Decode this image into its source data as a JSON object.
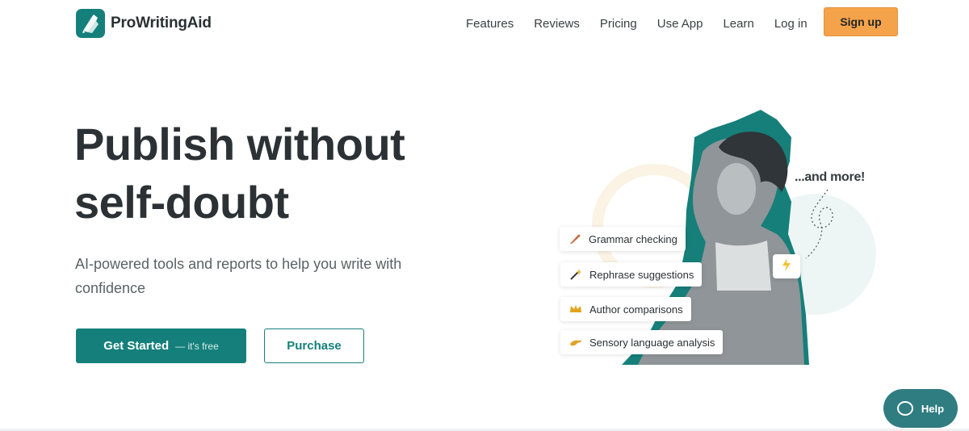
{
  "brand": {
    "name": "ProWritingAid",
    "accent": "#15807b",
    "signup_color": "#f5a34a"
  },
  "nav": {
    "items": [
      {
        "label": "Features"
      },
      {
        "label": "Reviews"
      },
      {
        "label": "Pricing"
      },
      {
        "label": "Use App"
      },
      {
        "label": "Learn"
      },
      {
        "label": "Log in"
      }
    ],
    "signup_label": "Sign up"
  },
  "hero": {
    "headline_line1": "Publish without",
    "headline_line2": "self-doubt",
    "subhead": "AI-powered tools and reports to help you write with confidence",
    "primary_label": "Get Started",
    "primary_sub": "— it's free",
    "secondary_label": "Purchase"
  },
  "illustration": {
    "and_more": "...and more!",
    "features": [
      {
        "label": "Grammar checking",
        "icon": "quill-icon"
      },
      {
        "label": "Rephrase suggestions",
        "icon": "magic-wand-icon"
      },
      {
        "label": "Author comparisons",
        "icon": "crown-icon"
      },
      {
        "label": "Sensory language analysis",
        "icon": "hand-icon"
      }
    ],
    "bolt_icon": "lightning-icon"
  },
  "help": {
    "label": "Help",
    "color": "#2f7c81"
  }
}
